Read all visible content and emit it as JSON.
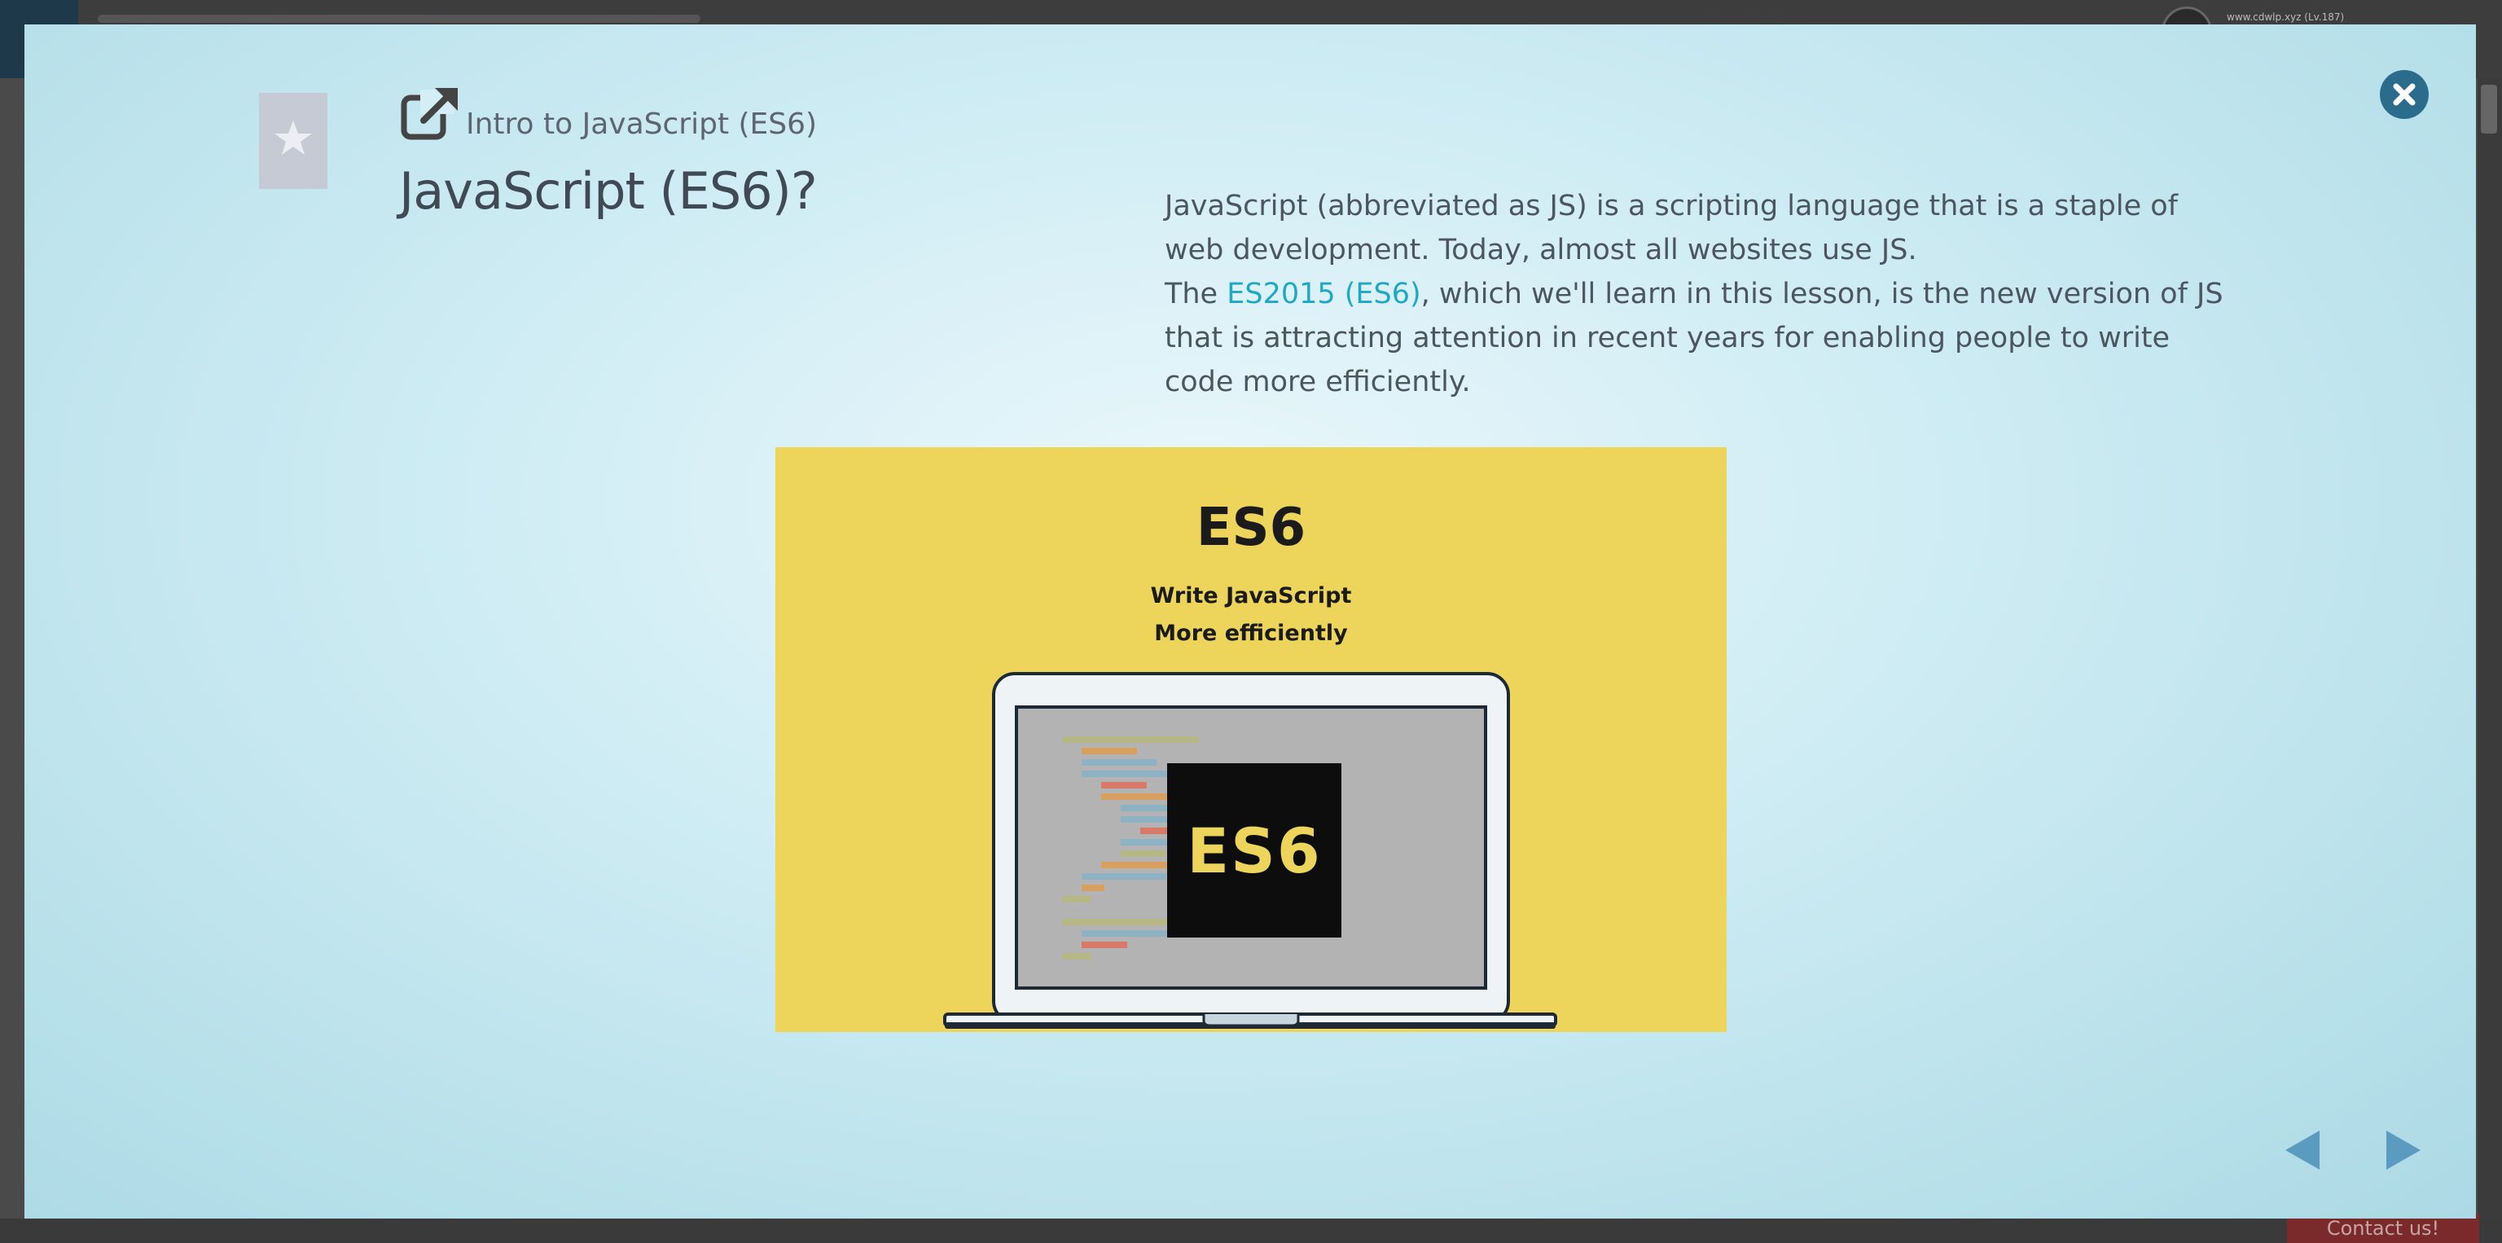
{
  "background": {
    "user_text": "www.cdwlp.xyz (Lv.187)",
    "contact_label": "Contact us!"
  },
  "modal": {
    "breadcrumb": "Intro to JavaScript (ES6)",
    "title": "JavaScript (ES6)?",
    "description": {
      "paragraph1": "JavaScript (abbreviated as JS) is a scripting language that is a staple of web development. Today, almost all websites use JS.",
      "paragraph2_before": "The ",
      "paragraph2_link": "ES2015 (ES6)",
      "paragraph2_after": ", which we'll learn in this lesson, is the new version of JS that is attracting attention in recent years for enabling people to write code more efficiently."
    },
    "illustration": {
      "heading": "ES6",
      "subline1": "Write JavaScript",
      "subline2": "More efficiently",
      "badge": "ES6"
    },
    "icons": {
      "bookmark": "bookmark-star-icon",
      "share": "external-link-icon",
      "close": "close-icon",
      "prev": "triangle-left-icon",
      "next": "triangle-right-icon"
    }
  },
  "colors": {
    "accent_link": "#1fa8c6",
    "close_button": "#2b6b8c",
    "illustration_bg": "#edd55c",
    "nav_arrow": "#5a9bbf"
  }
}
